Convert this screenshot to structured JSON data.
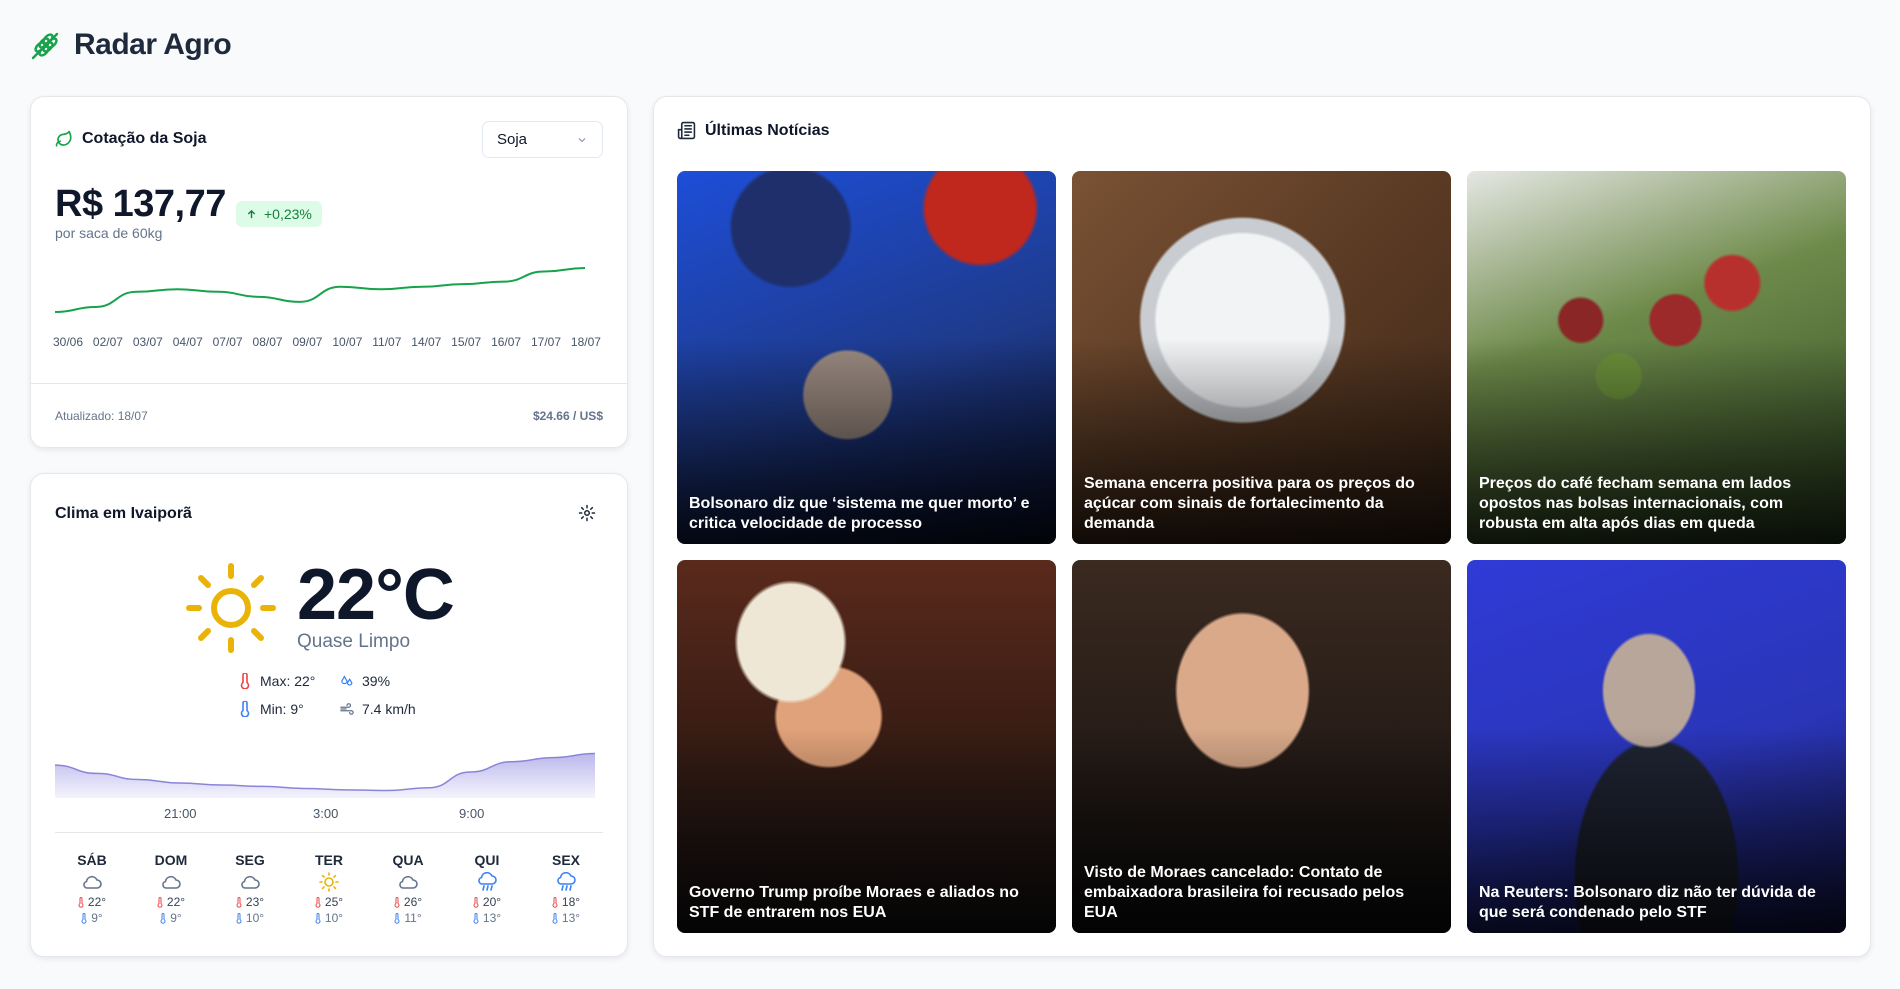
{
  "app": {
    "title": "Radar Agro"
  },
  "price": {
    "title": "Cotação da Soja",
    "select_value": "Soja",
    "value": "R$ 137,77",
    "change": "+0,23%",
    "unit": "por saca de 60kg",
    "dates": [
      "30/06",
      "02/07",
      "03/07",
      "04/07",
      "07/07",
      "08/07",
      "09/07",
      "10/07",
      "11/07",
      "14/07",
      "15/07",
      "16/07",
      "17/07",
      "18/07"
    ],
    "series": [
      136.9,
      137.0,
      137.3,
      137.35,
      137.3,
      137.2,
      137.1,
      137.4,
      137.35,
      137.4,
      137.45,
      137.5,
      137.7,
      137.77
    ],
    "updated": "Atualizado: 18/07",
    "fx": "$24.66 / US$",
    "line_color": "#16a34a"
  },
  "weather": {
    "title": "Clima em Ivaiporã",
    "temperature": "22°C",
    "condition": "Quase Limpo",
    "max": "Max: 22°",
    "min": "Min: 9°",
    "humidity": "39%",
    "wind": "7.4 km/h",
    "hour_labels": [
      "21:00",
      "3:00",
      "9:00"
    ],
    "hourly_series": [
      17.5,
      16.3,
      15.4,
      14.9,
      14.6,
      14.4,
      14.1,
      13.9,
      13.8,
      14.2,
      16.5,
      18.0,
      18.6,
      19.2
    ],
    "forecast": [
      {
        "day": "SÁB",
        "icon": "cloud-icon",
        "hi": "22°",
        "lo": "9°"
      },
      {
        "day": "DOM",
        "icon": "cloud-icon",
        "hi": "22°",
        "lo": "9°"
      },
      {
        "day": "SEG",
        "icon": "cloud-icon",
        "hi": "23°",
        "lo": "10°"
      },
      {
        "day": "TER",
        "icon": "sun-icon",
        "hi": "25°",
        "lo": "10°"
      },
      {
        "day": "QUA",
        "icon": "cloud-icon",
        "hi": "26°",
        "lo": "11°"
      },
      {
        "day": "QUI",
        "icon": "rain-icon",
        "hi": "20°",
        "lo": "13°"
      },
      {
        "day": "SEX",
        "icon": "rain-icon",
        "hi": "18°",
        "lo": "13°"
      }
    ],
    "accent": "#eab308"
  },
  "news": {
    "title": "Últimas Notícias",
    "items": [
      {
        "caption": "Bolsonaro diz que ‘sistema me quer morto’ e critica velocidade de processo"
      },
      {
        "caption": "Semana encerra positiva para os preços do açúcar com sinais de fortalecimento da demanda"
      },
      {
        "caption": "Preços do café fecham semana em lados opostos nas bolsas internacionais, com robusta em alta após dias em queda"
      },
      {
        "caption": "Governo Trump proíbe Moraes e aliados no STF de entrarem nos EUA"
      },
      {
        "caption": "Visto de Moraes cancelado: Contato de embaixadora brasileira foi recusado pelos EUA"
      },
      {
        "caption": "Na Reuters: Bolsonaro diz não ter dúvida de que será condenado pelo STF"
      }
    ]
  }
}
